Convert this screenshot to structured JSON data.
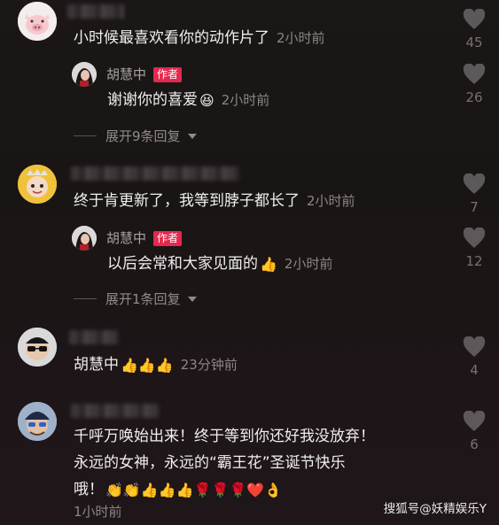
{
  "comments": [
    {
      "text": "小时候最喜欢看你的动作片了",
      "time": "2小时前",
      "likes": "45",
      "reply": {
        "author": "胡慧中",
        "badge": "作者",
        "text": "谢谢你的喜爱",
        "emoji": "😆",
        "time": "2小时前",
        "likes": "26"
      },
      "expand_label": "展开9条回复"
    },
    {
      "text": "终于肯更新了，我等到脖子都长了",
      "time": "2小时前",
      "likes": "7",
      "reply": {
        "author": "胡慧中",
        "badge": "作者",
        "text": "以后会常和大家见面的",
        "emoji": "👍",
        "time": "2小时前",
        "likes": "12"
      },
      "expand_label": "展开1条回复"
    },
    {
      "text": "胡慧中",
      "emoji": "👍👍👍",
      "time": "23分钟前",
      "likes": "4"
    },
    {
      "line1": "千呼万唤始出来！终于等到你还好我没放弃！",
      "line2": "永远的女神，永远的“霸王花”圣诞节快乐",
      "line3": "哦！",
      "emoji": "👏👏👍👍👍🌹🌹🌹❤️👌",
      "time": "1小时前",
      "likes": "6"
    }
  ],
  "watermark": "搜狐号@妖精娱乐Y"
}
